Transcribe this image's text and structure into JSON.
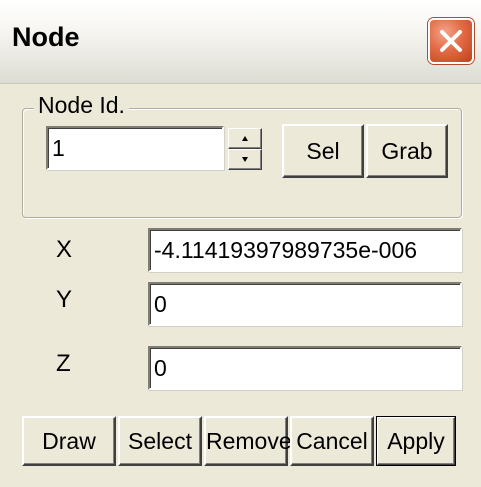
{
  "window": {
    "title": "Node"
  },
  "group": {
    "legend": "Node Id.",
    "node_id_value": "1",
    "sel_label": "Sel",
    "grab_label": "Grab"
  },
  "coordinates": {
    "x_label": "X",
    "x_value": "-4.11419397989735e-006",
    "y_label": "Y",
    "y_value": "0",
    "z_label": "Z",
    "z_value": "0"
  },
  "buttons": {
    "draw": "Draw",
    "select": "Select",
    "remove": "Remove",
    "cancel": "Cancel",
    "apply": "Apply"
  },
  "icons": {
    "close": "close-icon",
    "spin_up": "spin-up-icon",
    "spin_down": "spin-down-icon"
  },
  "colors": {
    "dialog_background": "#ece9d8",
    "close_button": "#e26b45"
  }
}
